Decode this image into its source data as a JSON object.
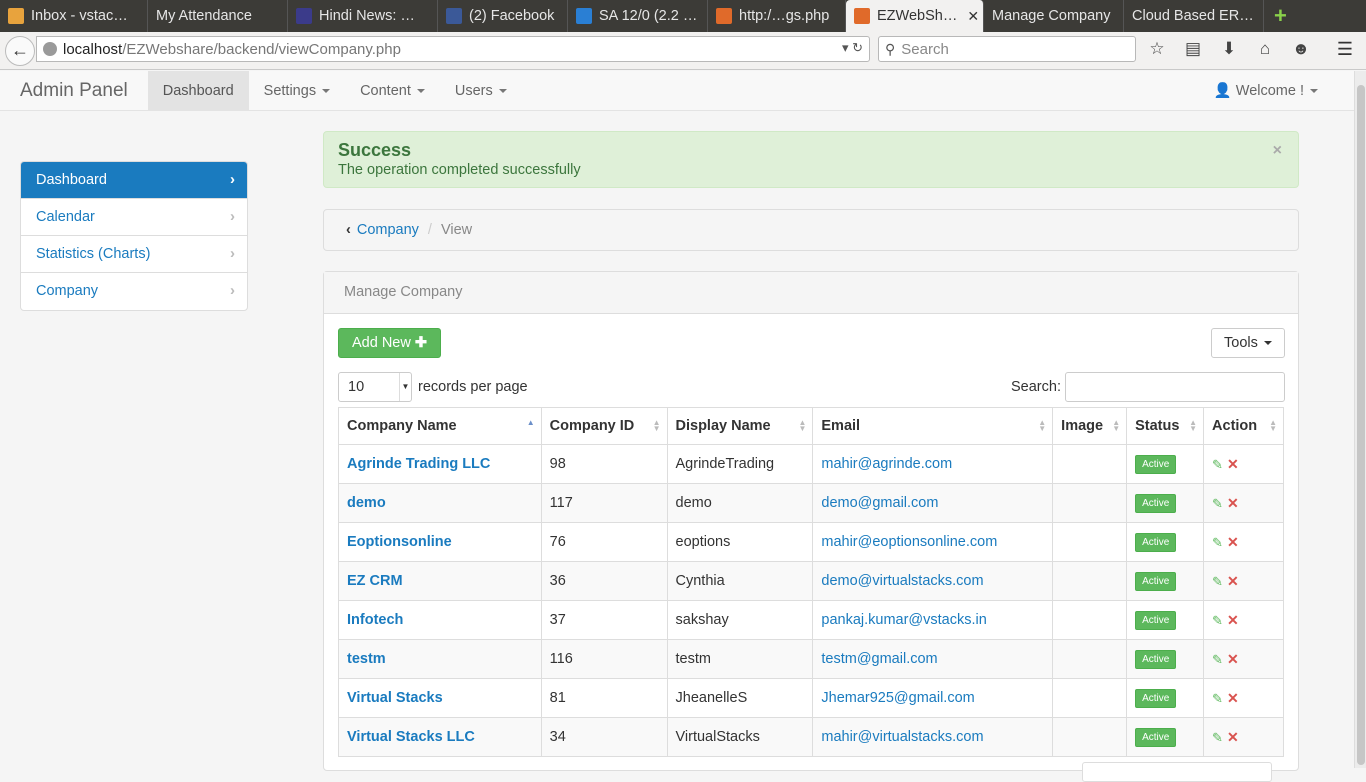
{
  "browser": {
    "tabs": [
      {
        "label": "Inbox - vstac…",
        "fav": "#e8a33d"
      },
      {
        "label": "My Attendance",
        "fav": ""
      },
      {
        "label": "Hindi News: …",
        "fav": "#3b3b8a"
      },
      {
        "label": "(2) Facebook",
        "fav": "#3b5998"
      },
      {
        "label": "SA 12/0 (2.2 …",
        "fav": "#2a7fd4"
      },
      {
        "label": "http:/…gs.php",
        "fav": "#e06a2a"
      },
      {
        "label": "EZWebSh…",
        "fav": "#e06a2a",
        "active": true
      },
      {
        "label": "Manage Company",
        "fav": ""
      },
      {
        "label": "Cloud Based ER…",
        "fav": ""
      }
    ],
    "url_host": "localhost",
    "url_path": "/EZWebshare/backend/viewCompany.php",
    "search_placeholder": "Search"
  },
  "header": {
    "brand": "Admin Panel",
    "nav": [
      "Dashboard",
      "Settings",
      "Content",
      "Users"
    ],
    "welcome": "Welcome !"
  },
  "sidebar": {
    "items": [
      "Dashboard",
      "Calendar",
      "Statistics (Charts)",
      "Company"
    ]
  },
  "alert": {
    "title": "Success",
    "message": "The operation completed successfully",
    "close": "×"
  },
  "breadcrumb": {
    "link": "Company",
    "current": "View"
  },
  "panel": {
    "title": "Manage Company",
    "add_label": "Add New",
    "tools_label": "Tools",
    "per_page_value": "10",
    "per_page_label": "records per page",
    "search_label": "Search:"
  },
  "table": {
    "headers": [
      "Company Name",
      "Company ID",
      "Display Name",
      "Email",
      "Image",
      "Status",
      "Action"
    ],
    "rows": [
      {
        "name": "Agrinde Trading LLC",
        "id": "98",
        "display": "AgrindeTrading",
        "email": "mahir@agrinde.com",
        "status": "Active"
      },
      {
        "name": "demo",
        "id": "117",
        "display": "demo",
        "email": "demo@gmail.com",
        "status": "Active"
      },
      {
        "name": "Eoptionsonline",
        "id": "76",
        "display": "eoptions",
        "email": "mahir@eoptionsonline.com",
        "status": "Active"
      },
      {
        "name": "EZ CRM",
        "id": "36",
        "display": "Cynthia",
        "email": "demo@virtualstacks.com",
        "status": "Active"
      },
      {
        "name": "Infotech",
        "id": "37",
        "display": "sakshay",
        "email": "pankaj.kumar@vstacks.in",
        "status": "Active"
      },
      {
        "name": "testm",
        "id": "116",
        "display": "testm",
        "email": "testm@gmail.com",
        "status": "Active"
      },
      {
        "name": "Virtual Stacks",
        "id": "81",
        "display": "JheanelleS",
        "email": "Jhemar925@gmail.com",
        "status": "Active"
      },
      {
        "name": "Virtual Stacks LLC",
        "id": "34",
        "display": "VirtualStacks",
        "email": "mahir@virtualstacks.com",
        "status": "Active"
      }
    ]
  }
}
